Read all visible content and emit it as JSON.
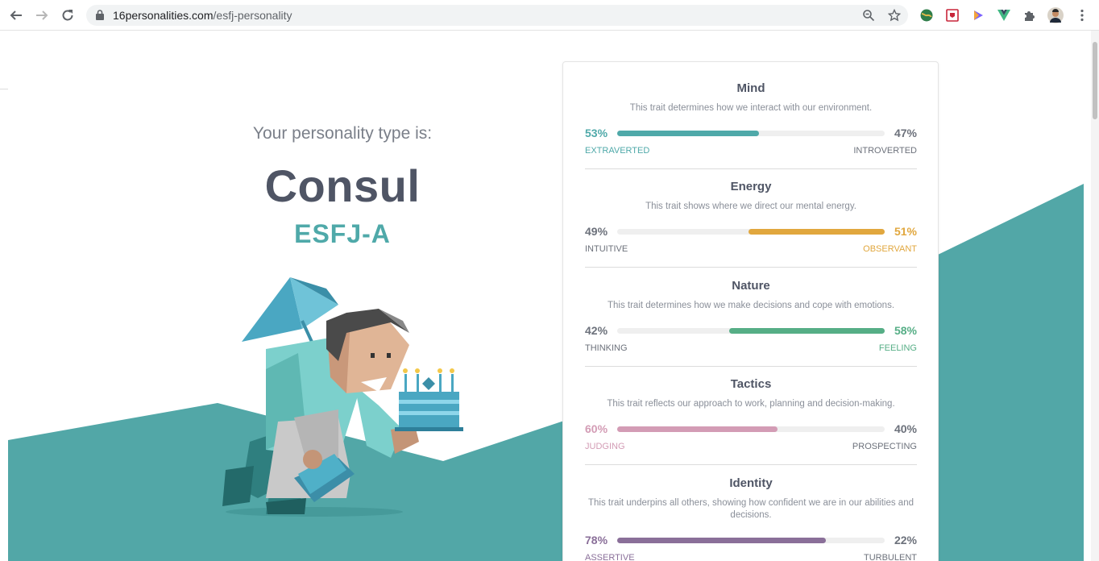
{
  "browser": {
    "url_host": "16personalities.com",
    "url_path": "/esfj-personality"
  },
  "hero": {
    "intro": "Your personality type is:",
    "type_name": "Consul",
    "type_code": "ESFJ-A"
  },
  "colors": {
    "teal": "#4fa9a9",
    "yellow": "#e1a73e",
    "green": "#56ae86",
    "pink": "#d39cb5",
    "purple": "#8a6f99"
  },
  "traits": [
    {
      "title": "Mind",
      "description": "This trait determines how we interact with our environment.",
      "left_pct": "53%",
      "right_pct": "47%",
      "left_label": "EXTRAVERTED",
      "right_label": "INTROVERTED",
      "dominant": "left",
      "fraction": 0.53,
      "color": "#4fa9a9"
    },
    {
      "title": "Energy",
      "description": "This trait shows where we direct our mental energy.",
      "left_pct": "49%",
      "right_pct": "51%",
      "left_label": "INTUITIVE",
      "right_label": "OBSERVANT",
      "dominant": "right",
      "fraction": 0.51,
      "color": "#e1a73e"
    },
    {
      "title": "Nature",
      "description": "This trait determines how we make decisions and cope with emotions.",
      "left_pct": "42%",
      "right_pct": "58%",
      "left_label": "THINKING",
      "right_label": "FEELING",
      "dominant": "right",
      "fraction": 0.58,
      "color": "#56ae86"
    },
    {
      "title": "Tactics",
      "description": "This trait reflects our approach to work, planning and decision-making.",
      "left_pct": "60%",
      "right_pct": "40%",
      "left_label": "JUDGING",
      "right_label": "PROSPECTING",
      "dominant": "left",
      "fraction": 0.6,
      "color": "#d39cb5"
    },
    {
      "title": "Identity",
      "description": "This trait underpins all others, showing how confident we are in our abilities and decisions.",
      "left_pct": "78%",
      "right_pct": "22%",
      "left_label": "ASSERTIVE",
      "right_label": "TURBULENT",
      "dominant": "left",
      "fraction": 0.78,
      "color": "#8a6f99"
    }
  ]
}
